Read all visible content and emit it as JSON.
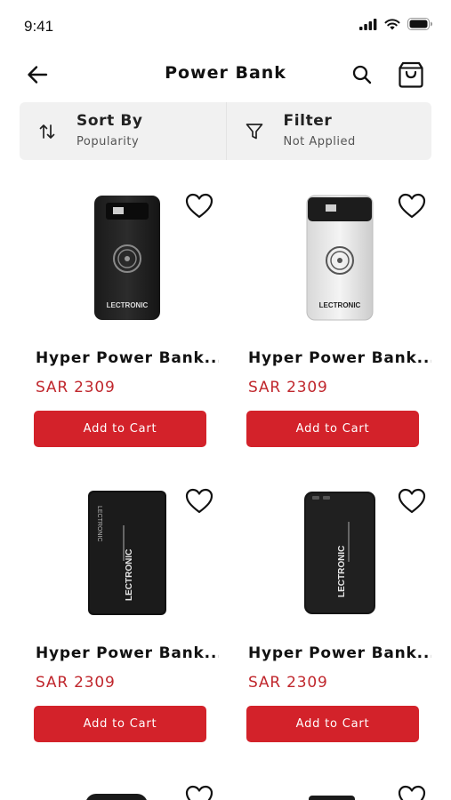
{
  "status": {
    "time": "9:41",
    "icons": [
      "cellular-signal-icon",
      "wifi-icon",
      "battery-icon"
    ]
  },
  "header": {
    "title": "Power Bank",
    "back_icon": "back-arrow-icon",
    "search_icon": "search-icon",
    "cart_icon": "shopping-bag-icon"
  },
  "sort": {
    "title": "Sort By",
    "value": "Popularity",
    "icon": "sort-arrows-icon"
  },
  "filter": {
    "title": "Filter",
    "value": "Not Applied",
    "icon": "funnel-icon"
  },
  "products": [
    {
      "name": "Hyper Power Bank...",
      "price": "SAR 2309",
      "button": "Add to Cart",
      "image": "black-wireless-power-bank",
      "brand": "LECTRONIC"
    },
    {
      "name": "Hyper Power Bank...",
      "price": "SAR 2309",
      "button": "Add to Cart",
      "image": "white-wireless-power-bank",
      "brand": "LECTRONIC"
    },
    {
      "name": "Hyper Power Bank...",
      "price": "SAR 2309",
      "button": "Add to Cart",
      "image": "black-pd-power-bank",
      "brand": "LECTRONIC"
    },
    {
      "name": "Hyper Power Bank...",
      "price": "SAR 2309",
      "button": "Add to Cart",
      "image": "black-usb-power-bank",
      "brand": "LECTRONIC"
    }
  ],
  "colors": {
    "accent": "#d3222a",
    "price": "#c0272d",
    "panel": "#f1f1f1"
  }
}
